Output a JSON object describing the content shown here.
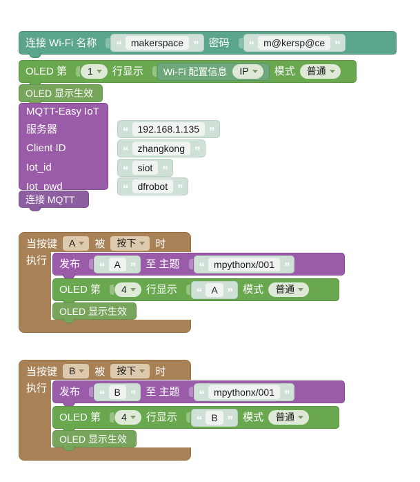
{
  "app": {
    "type": "blockly-visual-program",
    "background": "#ffffff"
  },
  "colors": {
    "teal": "#5ba58c",
    "green": "#6aa84f",
    "green_light": "#76a55b",
    "purple": "#9a5ba8",
    "brown": "#a98156",
    "text_block": "#cfe0d6",
    "field": "#f0f4f1"
  },
  "program": {
    "setup_stack": {
      "wifi_connect": {
        "label_connect": "连接 Wi-Fi 名称",
        "ssid_value": "makerspace",
        "label_password": "密码",
        "password_value": "m@kersp@ce",
        "quote_open": "“",
        "quote_close": "”"
      },
      "oled_show_line": {
        "label_prefix": "OLED 第",
        "line_number": "1",
        "label_row": "行显示",
        "content_block": "Wi-Fi 配置信息",
        "content_option": "IP",
        "label_mode": "模式",
        "mode_option": "普通"
      },
      "oled_refresh": {
        "label": "OLED 显示生效"
      },
      "mqtt_group": {
        "title": "MQTT-Easy IoT",
        "rows": [
          {
            "label": "服务器",
            "value": "192.168.1.135"
          },
          {
            "label": "Client ID",
            "value": "zhangkong"
          },
          {
            "label": "Iot_id",
            "value": "siot"
          },
          {
            "label": "Iot_pwd",
            "value": "dfrobot"
          }
        ],
        "connect_label": "连接 MQTT"
      }
    },
    "event_blocks": [
      {
        "hat": {
          "label_when": "当按键",
          "key": "A",
          "label_pressed_by": "被",
          "action": "按下",
          "label_time": "时",
          "label_do": "执行"
        },
        "publish": {
          "label_publish": "发布",
          "message": "A",
          "label_to_topic": "至 主题",
          "topic": "mpythonx/001",
          "quote_open": "“",
          "quote_close": "”"
        },
        "oled_show_line": {
          "label_prefix": "OLED 第",
          "line_number": "4",
          "label_row": "行显示",
          "text_value": "A",
          "label_mode": "模式",
          "mode_option": "普通"
        },
        "oled_refresh": {
          "label": "OLED 显示生效"
        }
      },
      {
        "hat": {
          "label_when": "当按键",
          "key": "B",
          "label_pressed_by": "被",
          "action": "按下",
          "label_time": "时",
          "label_do": "执行"
        },
        "publish": {
          "label_publish": "发布",
          "message": "B",
          "label_to_topic": "至 主题",
          "topic": "mpythonx/001",
          "quote_open": "“",
          "quote_close": "”"
        },
        "oled_show_line": {
          "label_prefix": "OLED 第",
          "line_number": "4",
          "label_row": "行显示",
          "text_value": "B",
          "label_mode": "模式",
          "mode_option": "普通"
        },
        "oled_refresh": {
          "label": "OLED 显示生效"
        }
      }
    ]
  }
}
